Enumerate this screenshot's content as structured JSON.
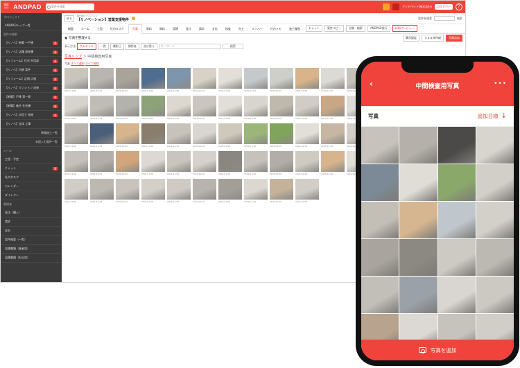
{
  "topbar": {
    "logo": "ANDPAD",
    "search_placeholder": "案件を検索",
    "user": "アンドパッド(株式会社)",
    "logout": "ログアウト",
    "help": "?"
  },
  "sidebar": {
    "sections": [
      {
        "title": "プロジェクト",
        "items": [
          {
            "label": "ANDPADトップ一覧"
          }
        ]
      },
      {
        "title": "案件の検索",
        "items": [
          {
            "label": "【リノベ】新築 一戸建",
            "badge": "6"
          },
          {
            "label": "【リノベ】店舗 改修棟",
            "badge": "6"
          },
          {
            "label": "【リフォーム】住宅 共用部",
            "badge": "6"
          },
          {
            "label": "【リノベ】内装 案件",
            "badge": "6"
          },
          {
            "label": "【リフォーム】定期 点検",
            "badge": "6"
          },
          {
            "label": "【リノベ】マンション 改修",
            "badge": "6"
          },
          {
            "label": "【新築】戸建 第一期",
            "badge": "6"
          },
          {
            "label": "【新築】集合 住宅棟",
            "badge": "6"
          },
          {
            "label": "【リノベ】水回り 改修",
            "badge": "6"
          },
          {
            "label": "【リノベ】全体 工事",
            "badge": ""
          },
          {
            "label": "現場施工一覧",
            "badge": "",
            "sub": true
          },
          {
            "label": "未読入力案件一覧",
            "badge": "",
            "sub": true
          }
        ]
      },
      {
        "title": "ツール",
        "items": [
          {
            "label": "工程・予定",
            "badge": ""
          },
          {
            "label": "チャット",
            "badge": "6"
          },
          {
            "label": "社内タスク",
            "badge": ""
          },
          {
            "label": "カレンダー",
            "badge": ""
          },
          {
            "label": "ダイレクト",
            "badge": ""
          }
        ]
      },
      {
        "title": "管理者",
        "items": [
          {
            "label": "発注（購入）",
            "badge": ""
          },
          {
            "label": "請求",
            "badge": ""
          },
          {
            "label": "支払",
            "badge": ""
          },
          {
            "label": "案件概要（一覧）",
            "badge": ""
          },
          {
            "label": "見積書類（業者別）",
            "badge": ""
          },
          {
            "label": "見積書類（担当別）",
            "badge": ""
          }
        ]
      }
    ]
  },
  "project": {
    "back": "戻る",
    "subtitle": "株式会社アンドパッド",
    "title": "【リノベーション】営業支援物件",
    "right_label": "案件を検索",
    "right_btn": "検索"
  },
  "tabs": [
    "概要",
    "ホーム",
    "工程",
    "社内タスク",
    "写真",
    "資料",
    "資料",
    "見積",
    "発注",
    "請求",
    "支払",
    "検査",
    "完工",
    "メンバー",
    "社内メモ",
    "施主履歴"
  ],
  "active_tab": 4,
  "tab_buttons": [
    {
      "label": "チャット",
      "red": false
    },
    {
      "label": "案件コピー",
      "red": false
    },
    {
      "label": "分類・検索",
      "red": false
    },
    {
      "label": "ANDPAD発行",
      "red": false
    },
    {
      "label": "印刷プレビュー",
      "red": true
    }
  ],
  "photo_header": {
    "title": "写真を整理する",
    "btns": [
      {
        "label": "表示設定",
        "red": false
      },
      {
        "label": "フォルダ作成",
        "red": false
      },
      {
        "label": "写真追加",
        "red": true
      }
    ]
  },
  "filter": {
    "label": "表示方法",
    "options": [
      {
        "label": "サムネイル",
        "red": true
      },
      {
        "label": "一覧",
        "red": false
      },
      {
        "label": "撮影日",
        "red": false
      },
      {
        "label": "撮影者",
        "red": false
      },
      {
        "label": "並び替え",
        "red": false
      }
    ],
    "input": "キーワード",
    "search": "検索"
  },
  "breadcrumb": {
    "root": "写真トップ",
    "sep": "＞",
    "current": "中間検査用写真"
  },
  "selection": {
    "label": "写真",
    "select_all": "すべて選択",
    "unselect": "すべて解除"
  },
  "photo_caption": "2021/11/10",
  "photo_colors": [
    [
      "#c9c5bd",
      "#b9b6b1",
      "#a9a39a",
      "#4f6d8f",
      "#7f95ad",
      "#d8d2c6",
      "#e3dfd8",
      "#c5c9cc",
      "#cfcfca",
      "#d9b38a",
      "#dcdad4",
      "#c6c2ba",
      "#9aa0a6",
      "#d4d0ca",
      "#bdb7ad",
      "#e0ddd7"
    ],
    [
      "#d7d3cd",
      "#c0bdb7",
      "#b4b2ad",
      "#8ea27a",
      "#dcd8d0",
      "#cac6bf",
      "#e1ded8",
      "#d8d5cf",
      "#bfb9ad",
      "#d1cdc6",
      "#c9a786",
      "#dedbd6",
      "#bcb6ad",
      "#d5d1ca",
      "#c7c3bc",
      "#a9a59e"
    ],
    [
      "#b9b5ae",
      "#4a5f7a",
      "#d6b48e",
      "#8b7d6b",
      "#c8c3ba",
      "#d9d6d1",
      "#cfc8bc",
      "#9bb57a",
      "#7fa45c",
      "#e2dfd9",
      "#c7b6a3",
      "#d3cfc8",
      "#d8d4ce",
      "#cbc7c0",
      "#bab4aa",
      "#dcd9d4"
    ],
    [
      "#c5c1ba",
      "#b3afa8",
      "#d2a67c",
      "#dcd8d2",
      "#c9c5be",
      "#d6d2cb",
      "#8a8780",
      "#c6c2bb",
      "#b2aea7",
      "#d0cbc2",
      "#d7b48d",
      "#e1ddd7",
      "#a7a39c",
      "#cdc9c2",
      "#c1bdb6",
      "#d9d5cf"
    ],
    [
      "#d0ccc6",
      "#bdb9b2",
      "#c8c4bd",
      "#d4d0c9",
      "#cfcbc4",
      "#b8b4ad",
      "#a39f98",
      "#dcd8d1",
      "#c4b29b",
      "#d2cec7"
    ]
  ],
  "phone": {
    "title": "中間検査用写真",
    "back": "‹",
    "more": "•••",
    "section": "写真",
    "sort": "追加日順",
    "sort_arrow": "↓",
    "footer": "写真を追加"
  },
  "phone_colors": [
    "#c7c3bc",
    "#b5b1aa",
    "#4c4a48",
    "#d8d5cf",
    "#7c8a98",
    "#e0ddd7",
    "#8aa86a",
    "#d2cec8",
    "#c4bfb6",
    "#d6b690",
    "#bfc6cc",
    "#d3d0ca",
    "#a9a59e",
    "#8c8882",
    "#cdc9c3",
    "#bcb8b2",
    "#c2beb8",
    "#9aa1a8",
    "#d9d6d1",
    "#ccc8c2",
    "#b8a48e",
    "#dcd9d4",
    "#c6c2bc",
    "#d1cdc7"
  ]
}
